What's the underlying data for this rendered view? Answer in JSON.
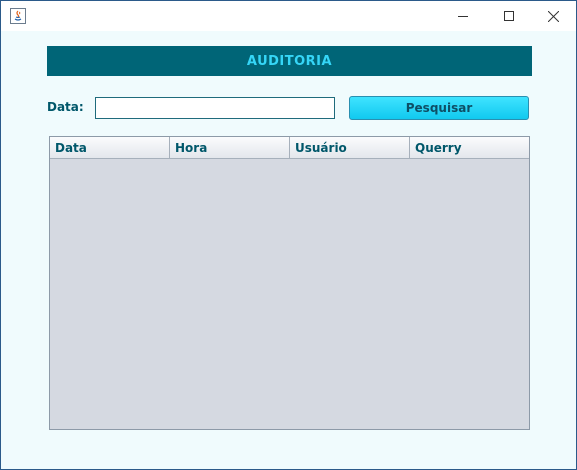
{
  "header": {
    "title": "AUDITORIA"
  },
  "form": {
    "date_label": "Data:",
    "date_value": "",
    "search_label": "Pesquisar"
  },
  "table": {
    "columns": [
      "Data",
      "Hora",
      "Usuário",
      "Querry"
    ],
    "rows": []
  },
  "colors": {
    "header_bg": "#006577",
    "header_text": "#35d6f7",
    "accent_button": "#11c9ef",
    "label_text": "#00576a",
    "window_bg": "#f0fbfd",
    "table_bg": "#d5d9e1"
  },
  "icons": {
    "app": "java-app-icon",
    "minimize": "minimize-icon",
    "maximize": "maximize-icon",
    "close": "close-icon"
  }
}
